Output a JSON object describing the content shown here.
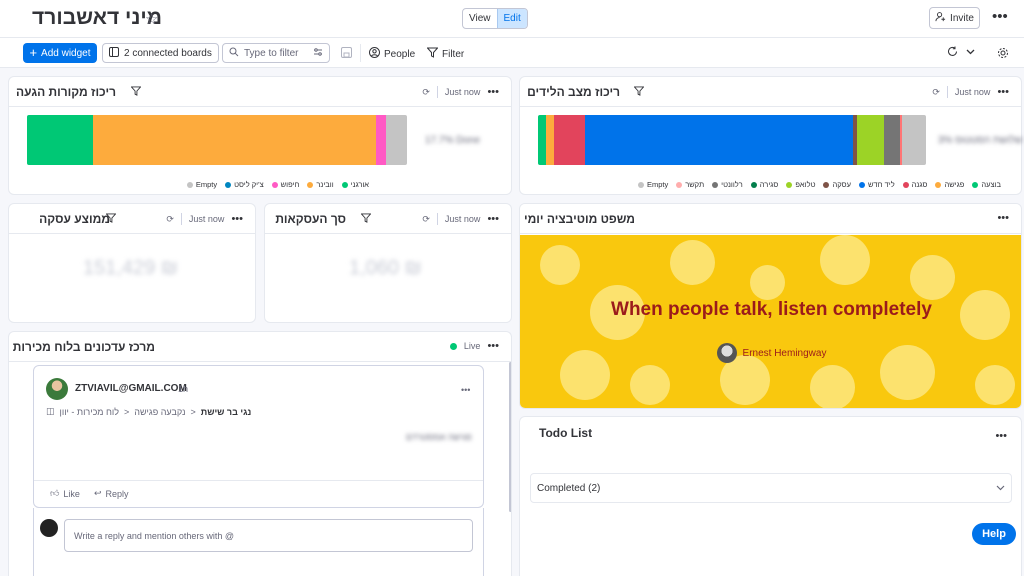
{
  "header": {
    "title": "מיני דאשבורד",
    "view_label": "View",
    "edit_label": "Edit",
    "invite_label": "Invite"
  },
  "toolbar": {
    "add_widget": "Add widget",
    "connected": "2 connected boards",
    "filter_placeholder": "Type to filter",
    "people": "People",
    "filter": "Filter"
  },
  "common": {
    "just_now": "Just now",
    "done_blur": "17.7% Done",
    "right_blur": "שלושת הסטטוס 3%"
  },
  "widgets": {
    "sources": {
      "title": "ריכוז מקורות הגעה",
      "segments": [
        {
          "color": "#00c875",
          "share": 0.19
        },
        {
          "color": "#fdab3d",
          "share": 0.81
        },
        {
          "color": "#e2445c",
          "share": 0.0
        },
        {
          "color": "#ff5ac4",
          "share": 0.03
        },
        {
          "color": "#c4c4c4",
          "share": 0.06
        }
      ],
      "legend": [
        {
          "label": "אורגני",
          "color": "#00c875"
        },
        {
          "label": "וובינר",
          "color": "#fdab3d"
        },
        {
          "label": "חיפוש",
          "color": "#ff5ac4"
        },
        {
          "label": "צ'יק ליסט",
          "color": "#0086c0"
        },
        {
          "label": "Empty",
          "color": "#c4c4c4"
        }
      ]
    },
    "leads": {
      "title": "ריכוז מצב הלידים",
      "segments": [
        {
          "color": "#00c875",
          "share": 0.02
        },
        {
          "color": "#fdab3d",
          "share": 0.02
        },
        {
          "color": "#e2445c",
          "share": 0.08
        },
        {
          "color": "#0073ea",
          "share": 0.675
        },
        {
          "color": "#7f5347",
          "share": 0.01
        },
        {
          "color": "#9cd326",
          "share": 0.07
        },
        {
          "color": "#757575",
          "share": 0.04
        },
        {
          "color": "#ff7575",
          "share": 0.005
        },
        {
          "color": "#c4c4c4",
          "share": 0.06
        }
      ],
      "legend": [
        {
          "label": "בוצעה",
          "color": "#00c875"
        },
        {
          "label": "פגישה",
          "color": "#fdab3d"
        },
        {
          "label": "סגנה",
          "color": "#e2445c"
        },
        {
          "label": "ליד חדש",
          "color": "#0073ea"
        },
        {
          "label": "עסקה",
          "color": "#7f5347"
        },
        {
          "label": "טלואפ",
          "color": "#9cd326"
        },
        {
          "label": "סגירה",
          "color": "#037f4c"
        },
        {
          "label": "רלוונטי",
          "color": "#757575"
        },
        {
          "label": "תקשר",
          "color": "#ffadad"
        },
        {
          "label": "Empty",
          "color": "#c4c4c4"
        }
      ]
    },
    "avg_deal": {
      "title": "ממוצע עסקה",
      "value": "151,429 ₪"
    },
    "sum_deals": {
      "title": "סך העסקאות",
      "value": "1,060 ₪"
    },
    "quote": {
      "title": "משפט מוטיבציה יומי",
      "text": "When people talk, listen completely",
      "author": "Ernest Hemingway"
    },
    "updates": {
      "title": "מרכז עדכונים בלוח מכירות",
      "live": "Live",
      "post": {
        "author": "ZTVIAVIL@GMAIL.COM",
        "time": "1h",
        "breadcrumb_item": "נגי בר שישת",
        "breadcrumb_group": "נקבעה פגישה",
        "breadcrumb_board": "לוח מכירות - יוון",
        "body": "פגישה אמסטרדם",
        "like": "Like",
        "reply": "Reply"
      },
      "reply_placeholder": "Write a reply and mention others with @"
    },
    "todo": {
      "title": "Todo List",
      "completed": "Completed (2)"
    }
  },
  "help": "Help"
}
